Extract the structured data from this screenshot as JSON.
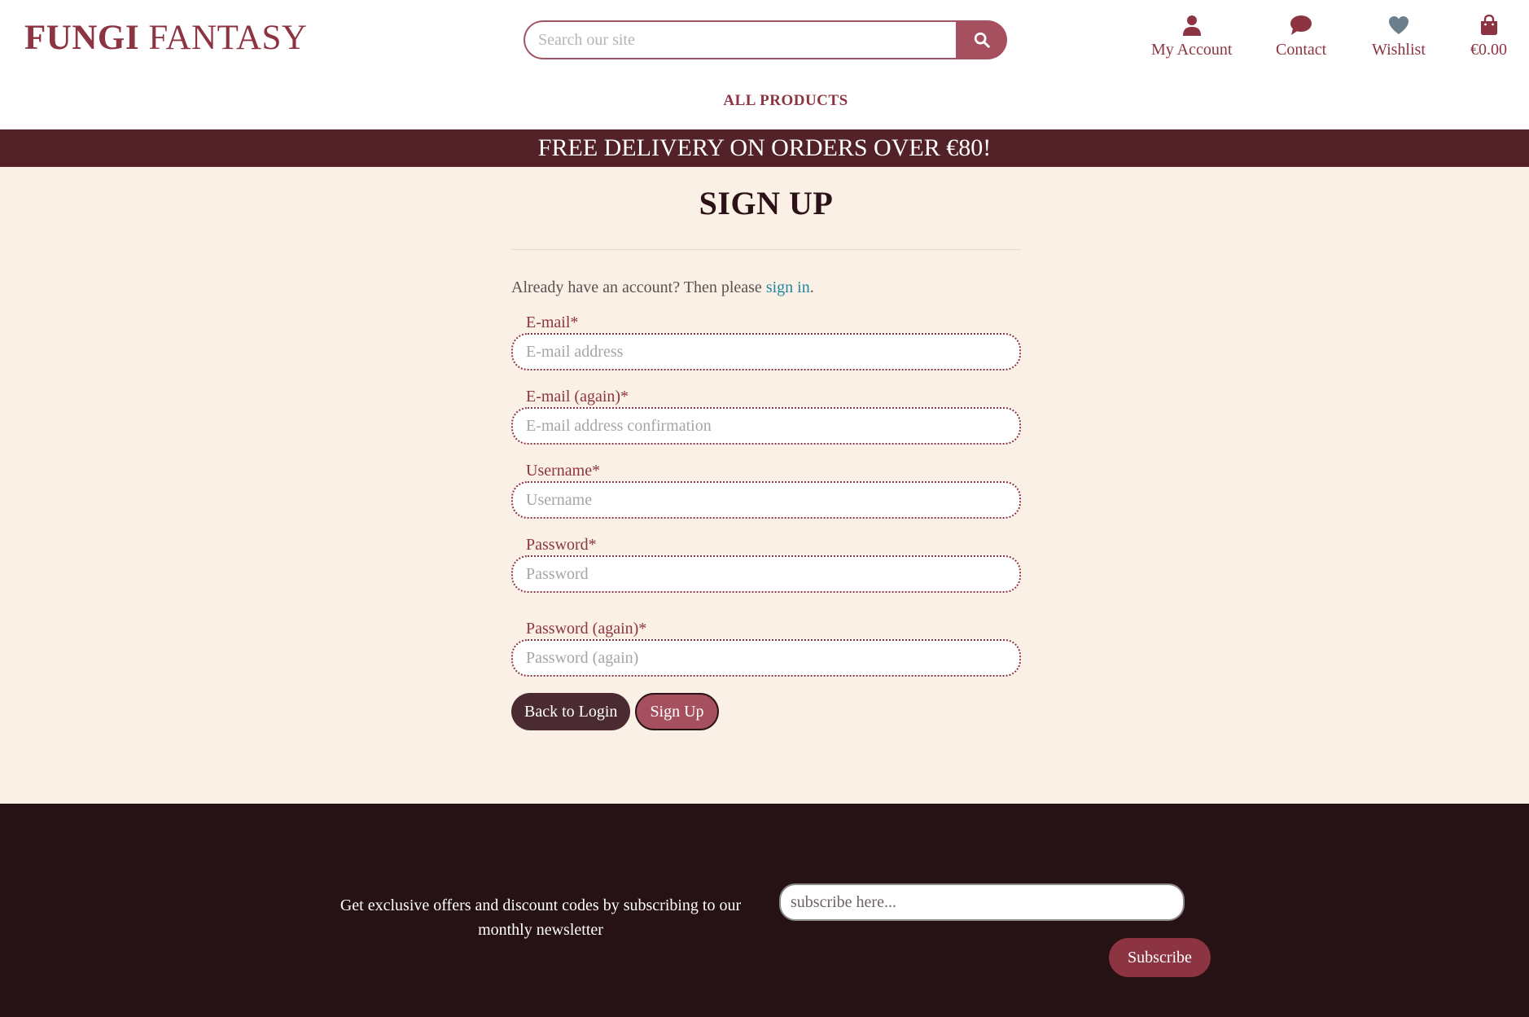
{
  "header": {
    "logo_bold": "FUNGI",
    "logo_regular": " FANTASY",
    "search_placeholder": "Search our site",
    "nav": {
      "account": "My Account",
      "contact": "Contact",
      "wishlist": "Wishlist",
      "cart": "€0.00"
    },
    "menu_all_products": "ALL PRODUCTS"
  },
  "banner": "FREE DELIVERY ON ORDERS OVER €80!",
  "signup": {
    "title": "SIGN UP",
    "already_text": "Already have an account? Then please ",
    "sign_in_link": "sign in",
    "already_end": ".",
    "fields": [
      {
        "label": "E-mail*",
        "placeholder": "E-mail address"
      },
      {
        "label": "E-mail (again)*",
        "placeholder": "E-mail address confirmation"
      },
      {
        "label": "Username*",
        "placeholder": "Username"
      },
      {
        "label": "Password*",
        "placeholder": "Password"
      },
      {
        "label": "Password (again)*",
        "placeholder": "Password (again)"
      }
    ],
    "back_button": "Back to Login",
    "signup_button": "Sign Up"
  },
  "footer": {
    "newsletter_text": "Get exclusive offers and discount codes by subscribing to our monthly newsletter",
    "subscribe_placeholder": "subscribe here...",
    "subscribe_button": "Subscribe"
  },
  "colors": {
    "brand": "#8c3442",
    "banner": "#532128",
    "page_bg": "#fbf0e5",
    "footer_bg": "#261114",
    "wishlist_icon": "#6d7f8b"
  },
  "icons": {
    "search": "search-icon",
    "account": "user-icon",
    "contact": "chat-bubble-icon",
    "wishlist": "heart-icon",
    "cart": "shopping-bag-icon"
  }
}
